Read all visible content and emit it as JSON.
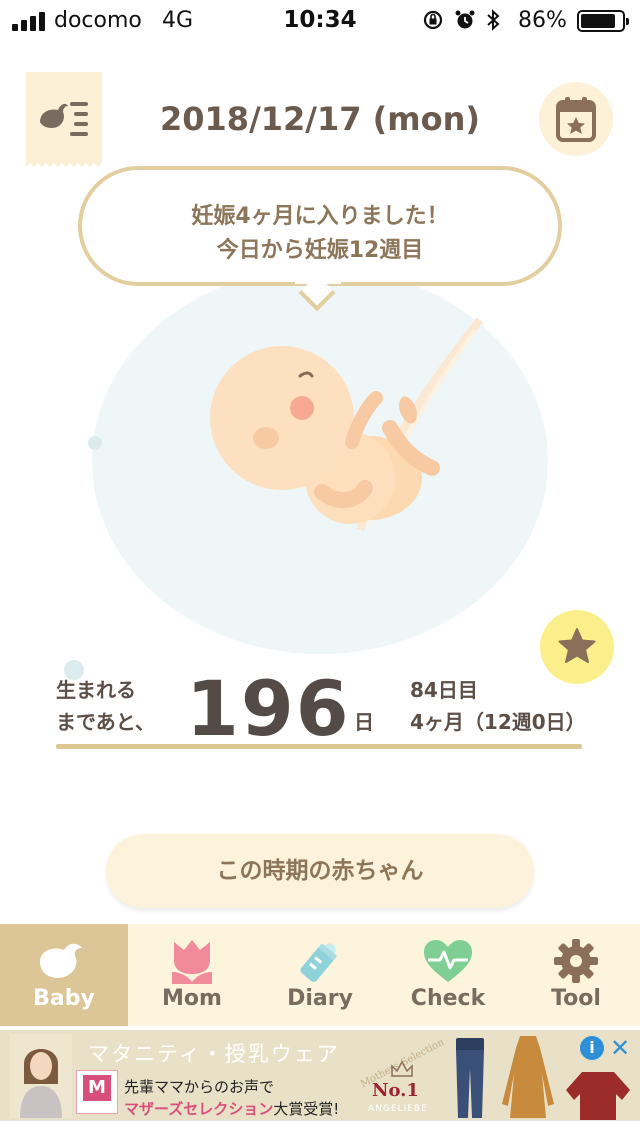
{
  "status_bar": {
    "carrier": "docomo",
    "network": "4G",
    "time": "10:34",
    "battery_percent": "86%",
    "battery_level": 0.86,
    "icons": [
      "orientation-lock-icon",
      "alarm-icon",
      "bluetooth-icon"
    ]
  },
  "header": {
    "date": "2018/12/17 (mon)",
    "menu_icon": "bird-menu-icon",
    "calendar_icon": "calendar-star-icon"
  },
  "bubble": {
    "line1": "妊娠4ヶ月に入りました！",
    "line2": "今日から妊娠12週目"
  },
  "countdown": {
    "label_line1": "生まれる",
    "label_line2": "まであと、",
    "days_left": "196",
    "unit": "日",
    "day_count": "84日目",
    "month_week": "4ヶ月（12週0日）"
  },
  "baby_button": {
    "label": "この時期の赤ちゃん"
  },
  "tabs": [
    {
      "label": "Baby",
      "icon": "bird-icon",
      "active": true
    },
    {
      "label": "Mom",
      "icon": "tulip-icon",
      "active": false
    },
    {
      "label": "Diary",
      "icon": "baby-bottle-icon",
      "active": false
    },
    {
      "label": "Check",
      "icon": "heart-pulse-icon",
      "active": false
    },
    {
      "label": "Tool",
      "icon": "gear-icon",
      "active": false
    }
  ],
  "ad": {
    "title": "マタニティ・授乳ウェア",
    "line1": "先輩ママからのお声で",
    "line2_highlight": "マザーズセレクション",
    "line2_rest": "大賞受賞!",
    "award": "No.1",
    "brand": "ANGELIEBE",
    "badge_text": "Mothers Selection",
    "logo_letter": "M"
  },
  "colors": {
    "accent_gold": "#dcc597",
    "text_brown": "#6b5a4e",
    "tab_bg": "#fdf4de",
    "favorite_yellow": "#fbef8c"
  }
}
